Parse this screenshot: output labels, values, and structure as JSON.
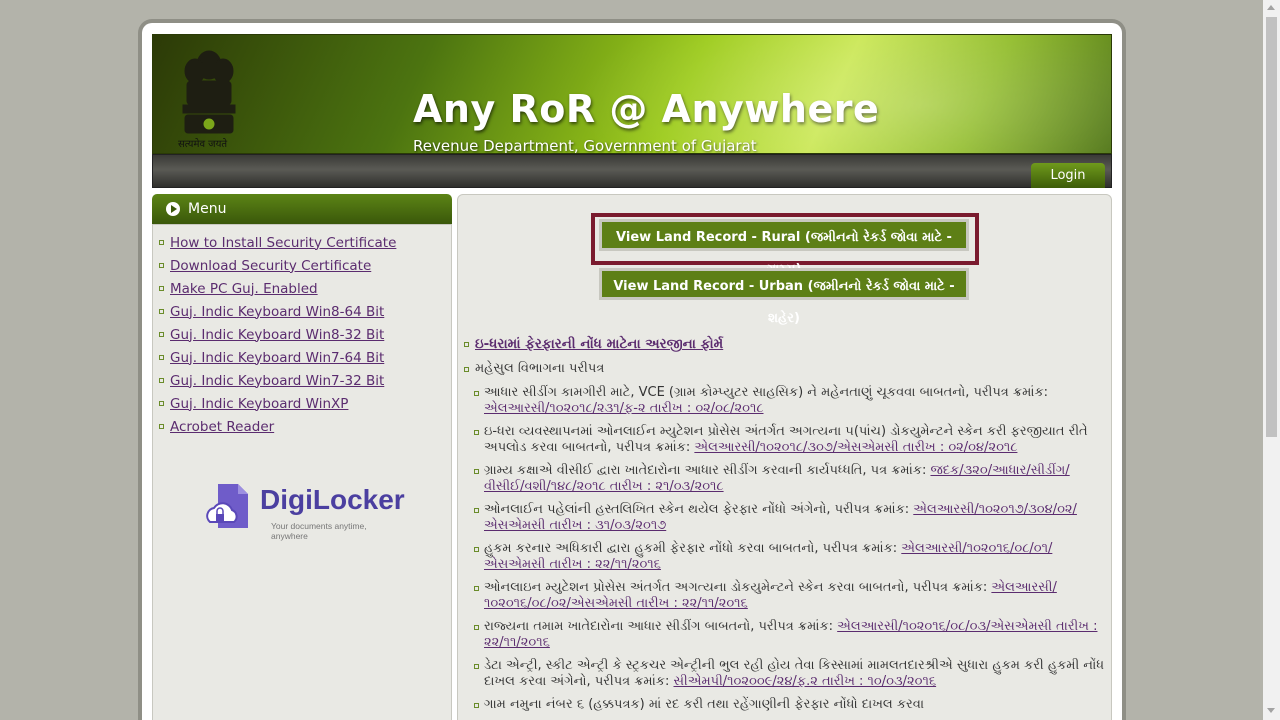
{
  "header": {
    "title": "Any RoR @ Anywhere",
    "subtitle": "Revenue Department, Government of Gujarat",
    "motto": "सत्यमेव जयते",
    "emblem_icon": "national-emblem-icon"
  },
  "nav": {
    "login_label": "Login"
  },
  "menu": {
    "title": "Menu",
    "items": [
      {
        "label": "How to Install Security Certificate"
      },
      {
        "label": "Download Security Certificate"
      },
      {
        "label": "Make PC Guj. Enabled"
      },
      {
        "label": "Guj. Indic Keyboard Win8-64 Bit"
      },
      {
        "label": "Guj. Indic Keyboard Win8-32 Bit"
      },
      {
        "label": "Guj. Indic Keyboard Win7-64 Bit"
      },
      {
        "label": "Guj. Indic Keyboard Win7-32 Bit"
      },
      {
        "label": "Guj. Indic Keyboard WinXP"
      },
      {
        "label": "Acrobet Reader"
      }
    ]
  },
  "digilocker": {
    "name": "DigiLocker",
    "tagline": "Your documents anytime, anywhere"
  },
  "buttons": {
    "rural": "View Land Record - Rural (જમીનનો રેકર્ડ જોવા માટે - ગ્રામ્ય)",
    "urban": "View Land Record - Urban (જમીનનો રેકર્ડ જોવા માટે - શહેર)"
  },
  "notices": {
    "top_link": "ઇ-ધરામાં ફેરફારની નોંધ માટેના અરજીના ફોર્મ",
    "section_title": "મહેસુલ વિભાગના પરીપત્ર",
    "items": [
      {
        "text": "આધાર સીડીંગ કામગીરી માટે, VCE (ગ્રામ કોમ્પ્યુટર સાહસિક) ને મહેનતાણું ચૂકવવા બાબતનો, પરીપત્ર ક્રમાંક: ",
        "link": "એલઆરસી/૧૦૨૦૧૮/૨૩૧/ફ-૨ તારીખ : ૦૨/૦૮/૨૦૧૮"
      },
      {
        "text": "ઇ-ધરા વ્યવસ્થાપનમાં ઓનલાઈન મ્યુટેશન પ્રોસેસ અંતર્ગત અગત્યના ૫(પાંચ) ડોકયુમેન્ટને સ્કેન કરી ફરજીયાત રીતે અપલોડ કરવા બાબતનો, પરીપત્ર ક્રમાંક: ",
        "link": "એલઆરસી/૧૦૨૦૧૮/૩૦૭/એસએમસી તારીખ : ૦૨/૦૪/૨૦૧૮"
      },
      {
        "text": "ગ્રામ્ય કક્ષાએ વીસીઈ દ્વારા ખાતેદારોના આધાર સીડીંગ કરવાની કાર્યપધ્ધતિ, પત્ર ક્રમાંક: ",
        "link": "જદક/૩૨૦/આધાર/સીડીંગ/વીસીઈ/વશી/૧૪૮/૨૦૧૮ તારીખ : ૨૧/૦૩/૨૦૧૮"
      },
      {
        "text": "ઓનલાઈન પહેલાંની હસ્તલિખિત સ્કેન થયેલ ફેરફાર નોંધો અંગેનો, પરીપત્ર ક્રમાંક: ",
        "link": "એલઆરસી/૧૦૨૦૧૭/૩૦૪/૦૨/એસએમસી તારીખ : ૩૧/૦૩/૨૦૧૭"
      },
      {
        "text": "હુકમ કરનાર અધિકારી દ્વારા હુકમી ફેરફાર નોંધો કરવા બાબતનો, પરીપત્ર ક્રમાંક: ",
        "link": "એલઆરસી/૧૦૨૦૧૬/૦૮/૦૧/એસએમસી તારીખ : ૨૨/૧૧/૨૦૧૬"
      },
      {
        "text": "ઓનલાઇન મ્યુટેશન પ્રોસેસ અંતર્ગત અગત્યના ડોકયુમેન્ટને સ્કેન કરવા બાબતનો, પરીપત્ર ક્રમાંક: ",
        "link": "એલઆરસી/૧૦૨૦૧૬/૦૮/૦૨/એસએમસી તારીખ : ૨૨/૧૧/૨૦૧૬"
      },
      {
        "text": "રાજ્યના તમામ ખાતેદારોના આધાર સીડીંગ બાબતનો, પરીપત્ર ક્રમાંક: ",
        "link": "એલઆરસી/૧૦૨૦૧૬/૦૮/૦૩/એસએમસી તારીખ : ૨૨/૧૧/૨૦૧૬"
      },
      {
        "text": "ડેટા એન્ટ્રી, સ્કીટ એન્ટ્રી કે સ્ટ્રકચર એન્ટ્રીની ભુલ રહી હોય તેવા કિસ્સામાં મામલતદારશ્રીએ સુધારા હુકમ કરી હુકમી નોંધ દાખલ કરવા અંગેનો, પરીપત્ર ક્રમાંક: ",
        "link": "સીએમપી/૧૦૨૦૦૯/૨૪/ફ.૨ તારીખ : ૧૦/૦૩/૨૦૧૬"
      },
      {
        "text": "ગામ નમુના નંબર ૬ (હક્કપત્રક) માં રદ કરી તથા રહેંગાણીની ફેરફાર નોંધો દાખલ કરવા",
        "link": ""
      }
    ]
  },
  "colors": {
    "accent_green": "#5d7f16",
    "highlight_border": "#7a1b2e",
    "link_purple": "#5b2c6f"
  }
}
